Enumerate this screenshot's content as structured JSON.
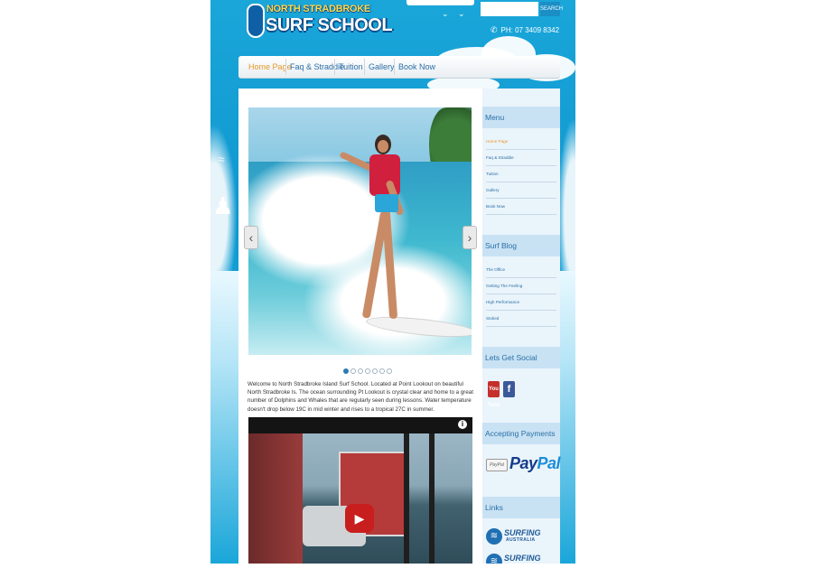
{
  "site": {
    "logo_line1": "NORTH STRADBROKE",
    "logo_line2": "SURF SCHOOL",
    "search_button": "SEARCH",
    "phone": "PH: 07 3409 8342"
  },
  "nav": {
    "items": [
      "Home Page",
      "Faq & Straddie",
      "Tuition",
      "Gallery",
      "Book Now"
    ],
    "active_index": 0
  },
  "slider": {
    "prev_label": "‹",
    "next_label": "›",
    "slide_count": 7,
    "active_slide": 1
  },
  "intro_text": "Welcome to North Stradbroke Island Surf School. Located at Point Lookout on beautiful North Stradbroke Is. The ocean surrounding Pt Lookout is crystal clear and home to a great number of Dolphins and Whales that are regularly seen during lessons. Water temperature doesn't drop below 19C in mid winter and rises to a tropical 27C in summer.",
  "video": {
    "info_label": "i",
    "play_label": "▶"
  },
  "sidebar": {
    "menu_heading": "Menu",
    "menu_items": [
      "Home Page",
      "Faq & Straddie",
      "Tuition",
      "Gallery",
      "Book Now"
    ],
    "blog_heading": "Surf Blog",
    "blog_items": [
      "The Office",
      "Getting The Feeling",
      "High Performance",
      "Stoked"
    ],
    "social_heading": "Lets Get Social",
    "youtube_label": "You Tube",
    "facebook_label": "f",
    "payments_heading": "Accepting Payments",
    "paypal_small": "PayPal",
    "paypal_big_1": "Pay",
    "paypal_big_2": "Pal",
    "links_heading": "Links",
    "link_logo_1a": "SURFING",
    "link_logo_1b": "AUSTRALIA",
    "link_logo_2a": "SURFING"
  },
  "colors": {
    "accent_active": "#e89a29",
    "link_blue": "#2b6fa5",
    "page_blue": "#1aa6d9",
    "play_red": "#c81e1e"
  }
}
